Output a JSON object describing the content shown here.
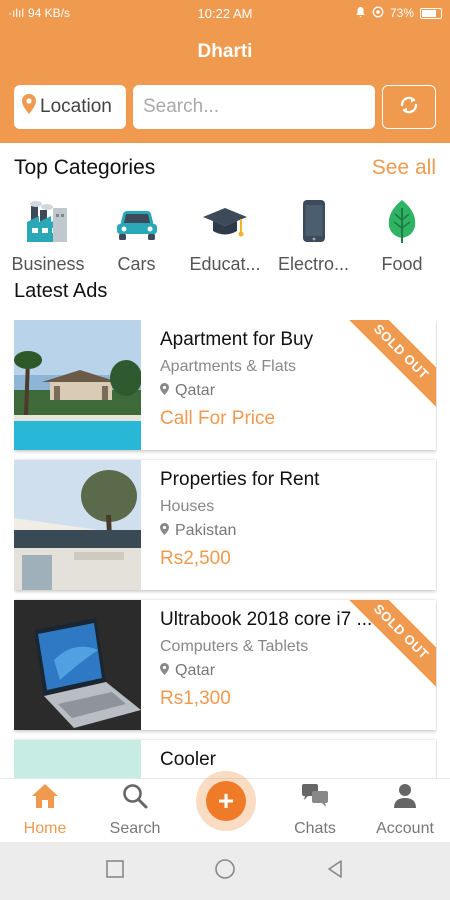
{
  "status_bar": {
    "signal": "·ılıl",
    "speed": "94 KB/s",
    "time": "10:22 AM",
    "battery": "73%"
  },
  "header": {
    "title": "Dharti",
    "location_label": "Location",
    "search_placeholder": "Search..."
  },
  "categories_section": {
    "title": "Top Categories",
    "see_all": "See all",
    "items": [
      {
        "label": "Business",
        "icon": "factory-icon"
      },
      {
        "label": "Cars",
        "icon": "car-icon"
      },
      {
        "label": "Educat...",
        "icon": "graduation-cap-icon"
      },
      {
        "label": "Electro...",
        "icon": "smartphone-icon"
      },
      {
        "label": "Food",
        "icon": "leaf-icon"
      }
    ]
  },
  "ads_section": {
    "title": "Latest Ads",
    "ads": [
      {
        "title": "Apartment for Buy",
        "category": "Apartments & Flats",
        "location": "Qatar",
        "price": "Call For Price",
        "ribbon": "SOLD OUT"
      },
      {
        "title": "Properties for Rent",
        "category": "Houses",
        "location": "Pakistan",
        "price": "Rs2,500",
        "ribbon": ""
      },
      {
        "title": "Ultrabook 2018 core i7 ... 16",
        "category": "Computers & Tablets",
        "location": "Qatar",
        "price": "Rs1,300",
        "ribbon": "SOLD OUT"
      },
      {
        "title": "Cooler",
        "category": "",
        "location": "",
        "price": "",
        "ribbon": ""
      }
    ]
  },
  "bottom_nav": {
    "home": "Home",
    "search": "Search",
    "post": "+",
    "chats": "Chats",
    "account": "Account"
  },
  "colors": {
    "accent": "#ef9a4f",
    "fab": "#ef7a28"
  }
}
